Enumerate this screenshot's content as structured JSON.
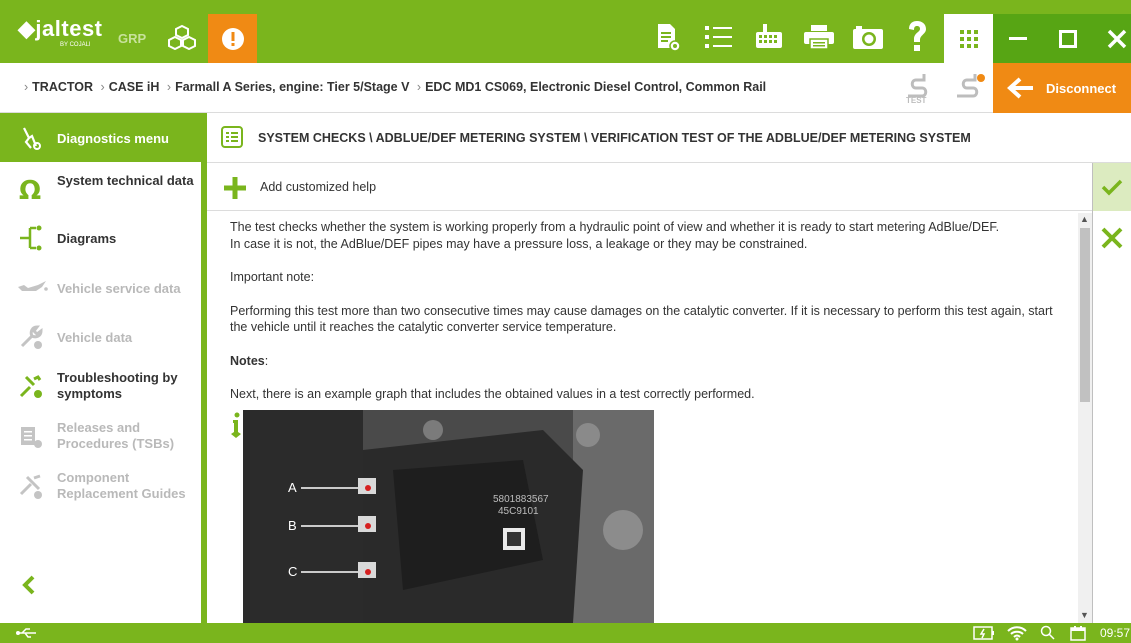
{
  "app": {
    "brand": "jaltest",
    "brand_sub": "BY COJALI",
    "edition": "GRP"
  },
  "colors": {
    "primary_green": "#7ab51d",
    "dark_green": "#57a514",
    "accent_orange": "#f08a14",
    "disabled_gray": "#b9b9b9"
  },
  "toolbar": {
    "icons": [
      "document-icon",
      "list-icon",
      "keyboard-icon",
      "printer-icon",
      "camera-icon",
      "help-icon",
      "apps-grid-icon"
    ],
    "window": [
      "minimize-icon",
      "maximize-icon",
      "close-icon"
    ]
  },
  "breadcrumb": {
    "items": [
      "TRACTOR",
      "CASE iH",
      "Farmall A Series, engine: Tier 5/Stage V",
      "EDC MD1 CS069, Electronic Diesel Control, Common Rail"
    ],
    "test_label": "TEST",
    "disconnect_label": "Disconnect"
  },
  "sidebar": {
    "header": "Diagnostics menu",
    "items": [
      {
        "label": "System technical data",
        "enabled": true
      },
      {
        "label": "Diagrams",
        "enabled": true
      },
      {
        "label": "Vehicle service data",
        "enabled": false
      },
      {
        "label": "Vehicle data",
        "enabled": false
      },
      {
        "label": "Troubleshooting by symptoms",
        "enabled": true
      },
      {
        "label": "Releases and Procedures (TSBs)",
        "enabled": false
      },
      {
        "label": "Component Replacement Guides",
        "enabled": false
      }
    ]
  },
  "main": {
    "title": "SYSTEM CHECKS \\ ADBLUE/DEF METERING SYSTEM \\ VERIFICATION TEST OF THE ADBLUE/DEF METERING SYSTEM",
    "help_label": "Add customized help",
    "paragraphs": {
      "p1": "The test checks whether the system is working properly from a hydraulic point of view and whether it is ready to start metering AdBlue/DEF.",
      "p1b": "In case it is not, the AdBlue/DEF pipes may have a pressure loss, a leakage or they may be constrained.",
      "important": "Important note:",
      "p2": "Performing this test more than two consecutive times may cause damages on the catalytic converter. If it is necessary to perform this test again, start the vehicle until it reaches the catalytic converter service temperature.",
      "notes": "Notes",
      "notes_colon": ":",
      "p3": "Next, there is an example graph that includes the obtained values in a test correctly performed."
    },
    "photo": {
      "labels": [
        "A",
        "B",
        "C"
      ],
      "part_number_1": "5801883567",
      "part_number_2": "45C9101"
    }
  },
  "statusbar": {
    "time": "09:57"
  }
}
